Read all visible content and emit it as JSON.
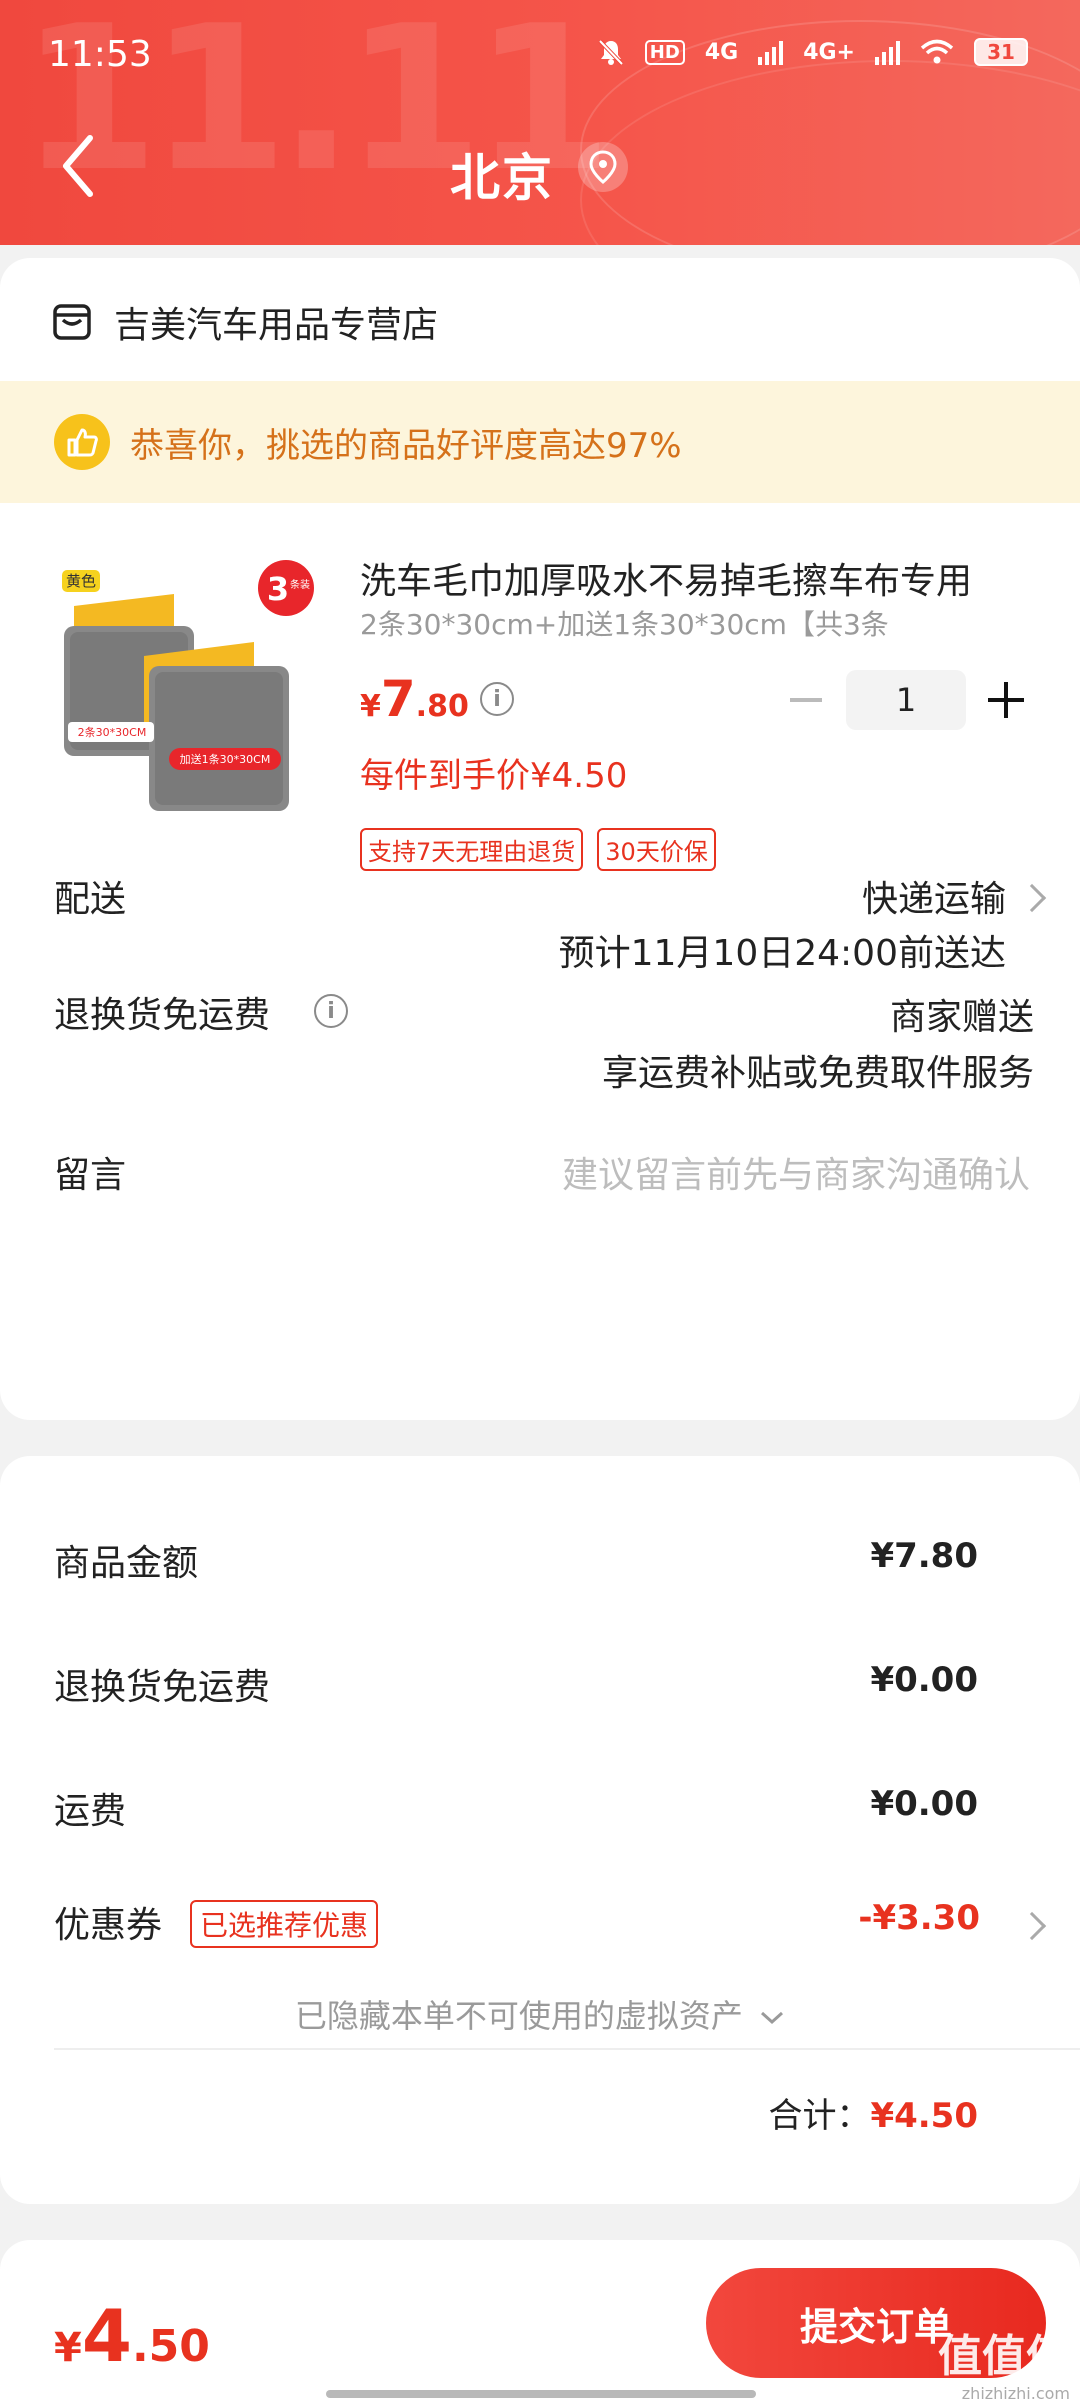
{
  "status": {
    "time": "11:53",
    "battery": "31",
    "net1": "4G",
    "net2": "4G+",
    "hd": "HD"
  },
  "header": {
    "city": "北京",
    "watermark": "11.11"
  },
  "store": {
    "name": "吉美汽车用品专营店"
  },
  "praise": {
    "text": "恭喜你，挑选的商品好评度高达97%"
  },
  "product": {
    "title": "洗车毛巾加厚吸水不易掉毛擦车布专用",
    "spec": "2条30*30cm+加送1条30*30cm【共3条",
    "price_currency": "¥",
    "price_int": "7",
    "price_dec": ".80",
    "quantity": "1",
    "each_price": "每件到手价¥4.50",
    "tags": [
      "支持7天无理由退货",
      "30天价保"
    ],
    "image": {
      "color_label": "黄色",
      "count_label": "3",
      "count_unit": "条装",
      "label_a": "2条30*30CM",
      "label_b": "加送1条30*30CM"
    }
  },
  "delivery": {
    "label": "配送",
    "method": "快递运输",
    "eta": "预计11月10日24:00前送达"
  },
  "return_shipping": {
    "label": "退换货免运费",
    "value": "商家赠送",
    "desc": "享运费补贴或免费取件服务"
  },
  "message": {
    "label": "留言",
    "placeholder": "建议留言前先与商家沟通确认"
  },
  "summary": {
    "goods_label": "商品金额",
    "goods_value": "¥7.80",
    "return_label": "退换货免运费",
    "return_value": "¥0.00",
    "freight_label": "运费",
    "freight_value": "¥0.00",
    "coupon_label": "优惠券",
    "coupon_tag": "已选推荐优惠",
    "coupon_value": "-¥3.30",
    "hidden_assets": "已隐藏本单不可使用的虚拟资产",
    "total_label": "合计：",
    "total_value": "¥4.50"
  },
  "bottom": {
    "price_currency": "¥",
    "price_int": "4",
    "price_dec": ".50",
    "submit_label": "提交订单",
    "watermark": "值值值",
    "watermark_sub": "zhizhizhi.com"
  },
  "colors": {
    "brand_red": "#e8321f",
    "header_red": "#f0483e",
    "praise_bg": "#fdf5dc",
    "praise_text": "#d5711a"
  }
}
